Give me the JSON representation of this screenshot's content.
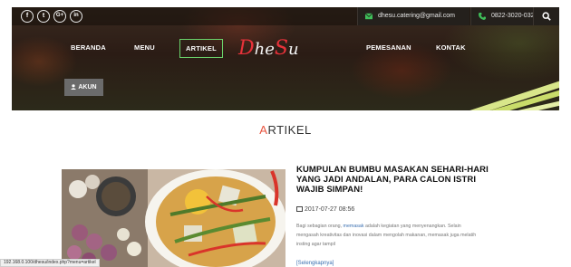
{
  "social": {
    "items": [
      {
        "name": "facebook",
        "glyph": "f"
      },
      {
        "name": "twitter",
        "glyph": "t"
      },
      {
        "name": "google-plus",
        "glyph": "G+"
      },
      {
        "name": "linkedin",
        "glyph": "in"
      }
    ]
  },
  "contact": {
    "email": "dhesu.catering@gmail.com",
    "phone": "0822-3020-0323"
  },
  "nav": {
    "beranda": "BERANDA",
    "menu": "MENU",
    "artikel": "ARTIKEL",
    "pemesanan": "PEMESANAN",
    "kontak": "KONTAK",
    "akun": "AKUN"
  },
  "logo": {
    "text_d": "D",
    "text_he": "he",
    "text_s": "S",
    "text_u": "u"
  },
  "section": {
    "title_first": "A",
    "title_rest": "RTIKEL"
  },
  "article": {
    "title": "KUMPULAN BUMBU MASAKAN SEHARI-HARI YANG JADI ANDALAN, PARA CALON ISTRI WAJIB SIMPAN!",
    "date": "2017-07-27 08:56",
    "body_1": "Bagi sebagian orang, ",
    "body_kw": "memasak",
    "body_2": " adalah kegiatan yang menyenangkan. Selain mengasah kreativitas dan inovasi dalam mengolah makanan, memasak juga melatih insting agar tampil",
    "more": "[Selengkapnya]"
  },
  "status": {
    "url": "192.168.0.100/dhesu/index.php?menu=artikel"
  },
  "colors": {
    "accent": "#e8543f",
    "active_border": "#6bd36b",
    "link": "#3a6fb0"
  }
}
